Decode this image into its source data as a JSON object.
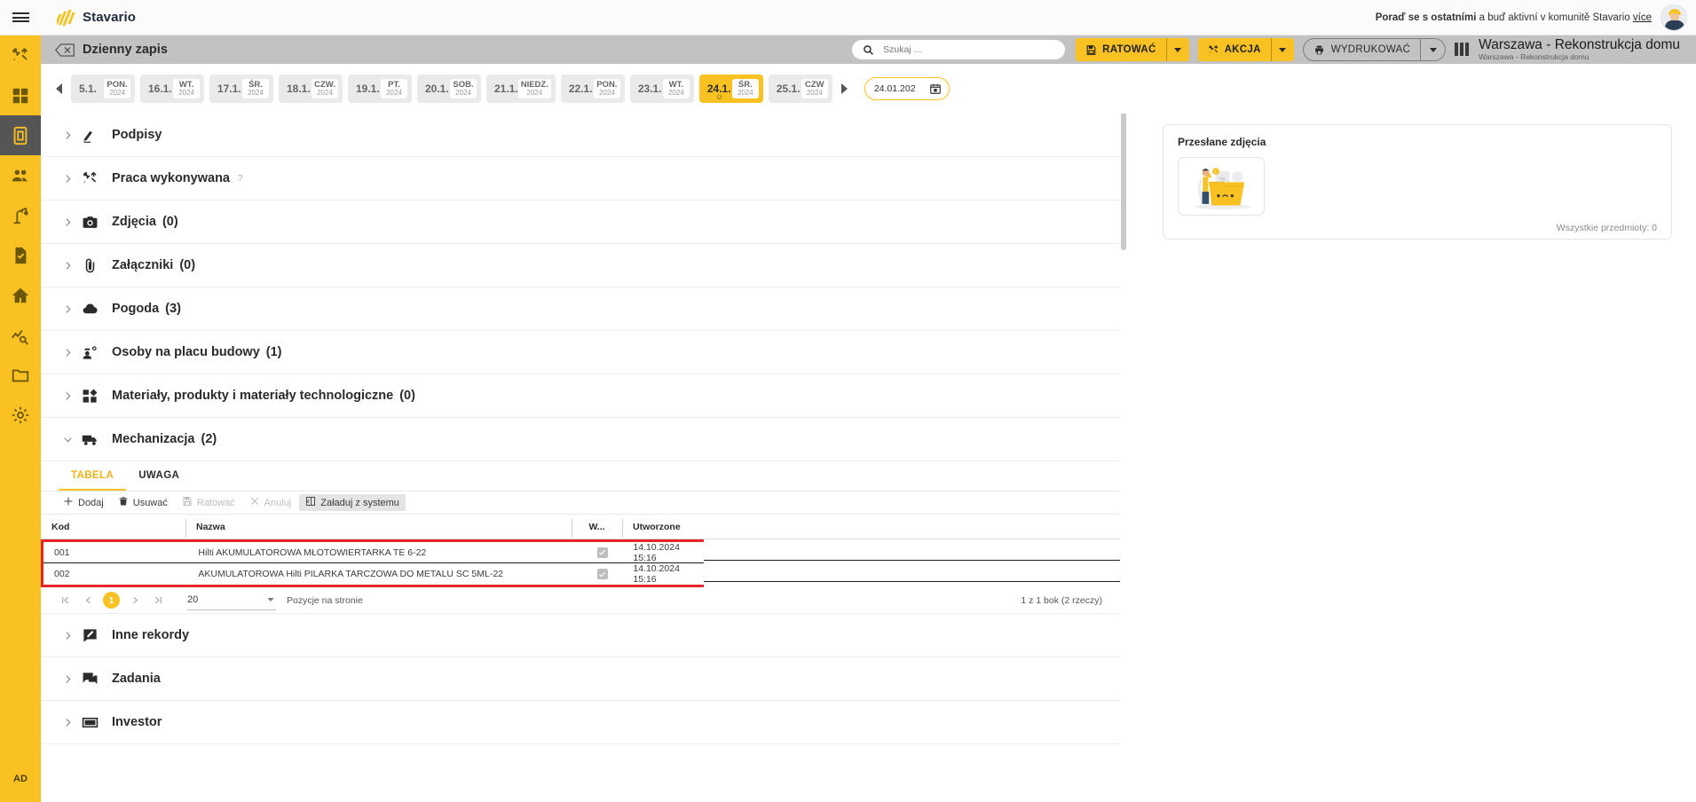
{
  "app": {
    "brand": "Stavario",
    "hamburger_label": "menu-toggle",
    "promo_bold": "Poraď se s ostatními",
    "promo_rest": " a buď aktivní v komunitě Stavario ",
    "promo_more": "více"
  },
  "sidebar": {
    "items": [
      {
        "name": "tools",
        "icon": "tools-icon",
        "active": false
      },
      {
        "name": "dashboard",
        "icon": "grid-icon",
        "active": false
      },
      {
        "name": "diary",
        "icon": "diary-icon",
        "active": true
      },
      {
        "name": "employees",
        "icon": "people-icon",
        "active": false
      },
      {
        "name": "machines",
        "icon": "crane-icon",
        "active": false
      },
      {
        "name": "documents-check",
        "icon": "doc-check-icon",
        "active": false
      },
      {
        "name": "home",
        "icon": "home-icon",
        "active": false
      },
      {
        "name": "reports",
        "icon": "chart-search-icon",
        "active": false
      },
      {
        "name": "folder",
        "icon": "folder-icon",
        "active": false
      },
      {
        "name": "settings",
        "icon": "gear-icon",
        "active": false
      }
    ],
    "badge": "AD"
  },
  "subheader": {
    "page_title": "Dzienny zapis",
    "search": {
      "placeholder": "Szukaj ...",
      "value": ""
    },
    "save_label": "RATOWAĆ",
    "action_label": "AKCJA",
    "print_label": "WYDRUKOWAĆ",
    "project_title": "Warszawa - Rekonstrukcja domu",
    "project_subtitle": "Warszawa - Rekonstrukcja domu"
  },
  "datestrip": {
    "days": [
      {
        "num": "5.1.",
        "dow": "PON.",
        "year": "2024",
        "selected": false
      },
      {
        "num": "16.1.",
        "dow": "WT.",
        "year": "2024",
        "selected": false
      },
      {
        "num": "17.1.",
        "dow": "ŚR.",
        "year": "2024",
        "selected": false
      },
      {
        "num": "18.1.",
        "dow": "CZW.",
        "year": "2024",
        "selected": false
      },
      {
        "num": "19.1.",
        "dow": "PT.",
        "year": "2024",
        "selected": false
      },
      {
        "num": "20.1.",
        "dow": "SOB.",
        "year": "2024",
        "selected": false
      },
      {
        "num": "21.1.",
        "dow": "NIEDZ.",
        "year": "2024",
        "selected": false
      },
      {
        "num": "22.1.",
        "dow": "PON.",
        "year": "2024",
        "selected": false
      },
      {
        "num": "23.1.",
        "dow": "WT.",
        "year": "2024",
        "selected": false
      },
      {
        "num": "24.1.",
        "dow": "ŚR.",
        "year": "2024",
        "selected": true
      },
      {
        "num": "25.1.",
        "dow": "CZW",
        "year": "2024",
        "selected": false
      }
    ],
    "date_value": "24.01.202"
  },
  "sections": [
    {
      "label": "Podpisy",
      "count": "",
      "icon": "signature-icon",
      "help": "",
      "expanded": false
    },
    {
      "label": "Praca wykonywana",
      "count": "",
      "icon": "tools-icon",
      "help": "?",
      "expanded": false
    },
    {
      "label": "Zdjęcia",
      "count": "(0)",
      "icon": "camera-icon",
      "help": "",
      "expanded": false
    },
    {
      "label": "Załączniki",
      "count": "(0)",
      "icon": "paperclip-icon",
      "help": "",
      "expanded": false
    },
    {
      "label": "Pogoda",
      "count": "(3)",
      "icon": "cloud-icon",
      "help": "",
      "expanded": false
    },
    {
      "label": "Osoby na placu budowy",
      "count": "(1)",
      "icon": "worker-icon",
      "help": "",
      "expanded": false
    },
    {
      "label": "Materiały, produkty i materiały technologiczne",
      "count": "(0)",
      "icon": "blocks-icon",
      "help": "",
      "expanded": false
    },
    {
      "label": "Mechanizacja",
      "count": "(2)",
      "icon": "truck-icon",
      "help": "",
      "expanded": true
    }
  ],
  "sections_bottom": [
    {
      "label": "Inne rekordy",
      "count": "",
      "icon": "note-icon",
      "expanded": false
    },
    {
      "label": "Zadania",
      "count": "",
      "icon": "comments-icon",
      "expanded": false
    },
    {
      "label": "Investor",
      "count": "",
      "icon": "money-icon",
      "expanded": false
    }
  ],
  "mechanizacja": {
    "tabs": [
      {
        "label": "TABELA",
        "active": true
      },
      {
        "label": "UWAGA",
        "active": false
      }
    ],
    "toolbar": [
      {
        "label": "Dodaj",
        "icon": "plus-icon",
        "disabled": false,
        "boxed": false
      },
      {
        "label": "Usuwać",
        "icon": "trash-icon",
        "disabled": false,
        "boxed": false
      },
      {
        "label": "Ratować",
        "icon": "save-icon",
        "disabled": true,
        "boxed": false
      },
      {
        "label": "Anuluj",
        "icon": "close-icon",
        "disabled": true,
        "boxed": false
      },
      {
        "label": "Załaduj z systemu",
        "icon": "import-icon",
        "disabled": false,
        "boxed": true
      }
    ],
    "columns": [
      "Kod",
      "Nazwa",
      "W...",
      "Utworzone"
    ],
    "rows": [
      {
        "kod": "001",
        "nazwa": "Hilti AKUMULATOROWA MŁOTOWIERTARKA TE 6-22",
        "w": true,
        "utworzone": "14.10.2024 15:16"
      },
      {
        "kod": "002",
        "nazwa": "AKUMULATOROWA Hilti PILARKA TARCZOWA DO METALU SC 5ML-22",
        "w": true,
        "utworzone": "14.10.2024 15:16"
      }
    ],
    "pager": {
      "current_page": "1",
      "page_size": "20",
      "page_size_label": "Pozycje na stronie",
      "summary": "1 z 1 bok (2 rzeczy)"
    },
    "highlight_color": "#e8232a"
  },
  "right_panel": {
    "title": "Przesłane zdjęcia",
    "total_label": "Wszystkie przedmioty: 0",
    "thumb_name": "empty-folder-illustration"
  },
  "colors": {
    "brand_yellow": "#f9c222",
    "subheader_gray": "#c2c2c2",
    "highlight_red": "#e8232a"
  }
}
